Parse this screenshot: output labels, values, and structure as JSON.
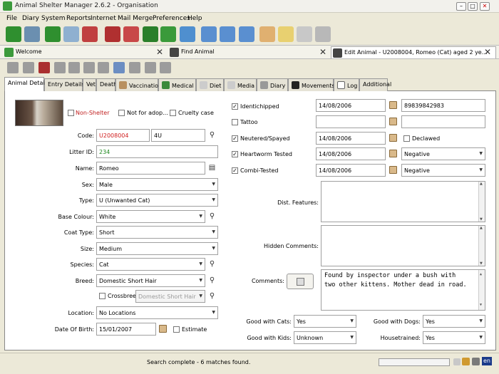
{
  "window": {
    "title": "Animal Shelter Manager 2.6.2 - Organisation"
  },
  "menu": [
    "File",
    "Diary",
    "System",
    "Reports",
    "Internet",
    "Mail Merge",
    "Preferences",
    "Help"
  ],
  "doc_tabs": {
    "welcome": "Welcome",
    "find": "Find Animal",
    "edit": "Edit Animal - U2008004, Romeo (Cat) aged 2 ye..."
  },
  "sub_tabs": [
    "Animal Details",
    "Entry Details",
    "Vet",
    "Death",
    "Vaccination",
    "Medical",
    "Diet",
    "Media",
    "Diary",
    "Movements",
    "Log",
    "Additional"
  ],
  "animal": {
    "flags": {
      "non_shelter": "Non-Shelter",
      "not_for_adoption": "Not for adop...",
      "cruelty_case": "Cruelty case"
    },
    "code_label": "Code:",
    "code": "U2008004",
    "short_code": "4U",
    "litter_label": "Litter ID:",
    "litter": "234",
    "name_label": "Name:",
    "name": "Romeo",
    "sex_label": "Sex:",
    "sex": "Male",
    "type_label": "Type:",
    "type": "U (Unwanted Cat)",
    "colour_label": "Base Colour:",
    "colour": "White",
    "coat_label": "Coat Type:",
    "coat": "Short",
    "size_label": "Size:",
    "size": "Medium",
    "species_label": "Species:",
    "species": "Cat",
    "breed_label": "Breed:",
    "breed": "Domestic Short Hair",
    "crossbreed_label": "Crossbreed",
    "breed2": "Domestic Short Hair",
    "location_label": "Location:",
    "location": "No Locations",
    "dob_label": "Date Of Birth:",
    "dob": "15/01/2007",
    "estimate_label": "Estimate"
  },
  "health": {
    "identichipped": {
      "label": "Identichipped",
      "date": "14/08/2006",
      "number": "89839842983"
    },
    "tattoo": {
      "label": "Tattoo"
    },
    "neutered": {
      "label": "Neutered/Spayed",
      "date": "14/08/2006",
      "declawed_label": "Declawed"
    },
    "heartworm": {
      "label": "Heartworm Tested",
      "date": "14/08/2006",
      "result": "Negative"
    },
    "combi": {
      "label": "Combi-Tested",
      "date": "14/08/2006",
      "result": "Negative"
    }
  },
  "notes": {
    "dist_label": "Dist. Features:",
    "hidden_label": "Hidden Comments:",
    "comments_label": "Comments:",
    "comments_line1": "Found by inspector under a bush with",
    "comments_line2": "two other kittens. Mother dead in road."
  },
  "good_with": {
    "cats_label": "Good with Cats:",
    "cats": "Yes",
    "dogs_label": "Good with Dogs:",
    "dogs": "Yes",
    "kids_label": "Good with Kids:",
    "kids": "Unknown",
    "housetrained_label": "Housetrained:",
    "housetrained": "Yes"
  },
  "status": {
    "message": "Search complete - 6 matches found.",
    "lang": "en"
  }
}
